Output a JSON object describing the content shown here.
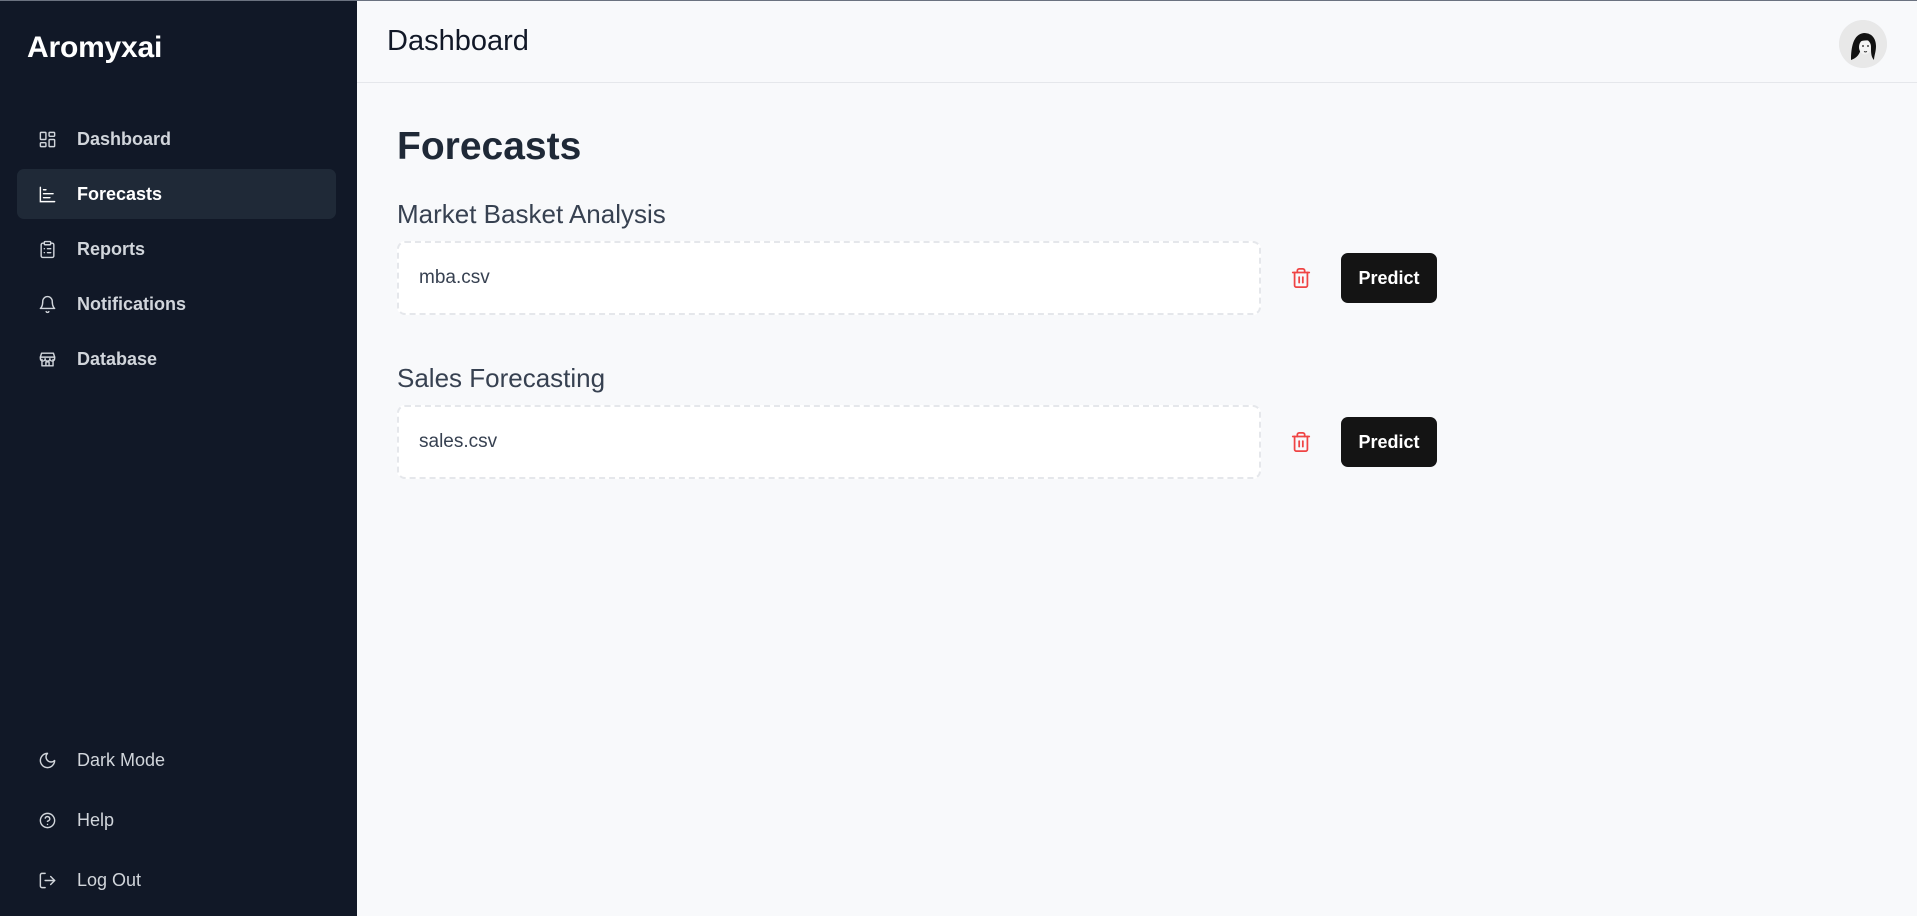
{
  "app": {
    "name": "Aromyxai"
  },
  "sidebar": {
    "items": [
      {
        "label": "Dashboard",
        "icon": "dashboard-icon"
      },
      {
        "label": "Forecasts",
        "icon": "chart-icon",
        "active": true
      },
      {
        "label": "Reports",
        "icon": "clipboard-icon"
      },
      {
        "label": "Notifications",
        "icon": "bell-icon"
      },
      {
        "label": "Database",
        "icon": "store-icon"
      }
    ],
    "bottom": [
      {
        "label": "Dark Mode",
        "icon": "moon-icon"
      },
      {
        "label": "Help",
        "icon": "help-circle-icon"
      },
      {
        "label": "Log Out",
        "icon": "logout-icon"
      }
    ]
  },
  "header": {
    "title": "Dashboard",
    "avatar_icon": "user-avatar"
  },
  "main": {
    "title": "Forecasts",
    "sections": [
      {
        "title": "Market Basket Analysis",
        "file": "mba.csv",
        "button": "Predict"
      },
      {
        "title": "Sales Forecasting",
        "file": "sales.csv",
        "button": "Predict"
      }
    ]
  },
  "colors": {
    "sidebar_bg": "#111827",
    "active_item_bg": "#1f2937",
    "page_bg": "#f8f9fb",
    "delete_red": "#ef4444",
    "button_bg": "#141414"
  }
}
